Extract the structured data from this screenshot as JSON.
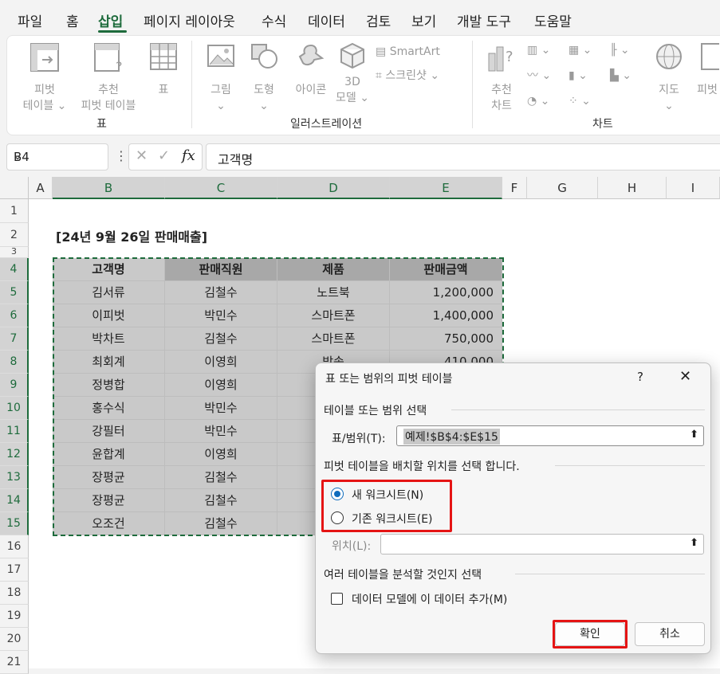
{
  "menu": {
    "tabs": [
      "파일",
      "홈",
      "삽입",
      "페이지 레이아웃",
      "수식",
      "데이터",
      "검토",
      "보기",
      "개발 도구",
      "도움말"
    ],
    "active": "삽입"
  },
  "ribbon": {
    "tables_group": {
      "label": "표",
      "pivot": [
        "피벗",
        "테이블"
      ],
      "recommended_pivot": [
        "추천",
        "피벗 테이블"
      ],
      "table": "표"
    },
    "illustrations_group": {
      "label": "일러스트레이션",
      "picture": "그림",
      "shapes": "도형",
      "icons": "아이콘",
      "model3d": [
        "3D",
        "모델"
      ],
      "smartart": "SmartArt",
      "screenshot": "스크린샷"
    },
    "charts_group": {
      "label": "차트",
      "recommended": [
        "추천",
        "차트"
      ],
      "map": "지도",
      "pivot_chart": "피벗"
    }
  },
  "formula_bar": {
    "name_box": "B4",
    "fx": "fx",
    "formula": "고객명"
  },
  "sheet": {
    "columns": [
      "A",
      "B",
      "C",
      "D",
      "E",
      "F",
      "G",
      "H",
      "I"
    ],
    "rows": [
      "1",
      "2",
      "3",
      "4",
      "5",
      "6",
      "7",
      "8",
      "9",
      "10",
      "11",
      "12",
      "13",
      "14",
      "15",
      "16",
      "17",
      "18",
      "19",
      "20",
      "21"
    ],
    "title": "[24년 9월 26일 판매매출]",
    "headers": [
      "고객명",
      "판매직원",
      "제품",
      "판매금액"
    ],
    "data": [
      [
        "김서류",
        "김철수",
        "노트북",
        "1,200,000"
      ],
      [
        "이피벗",
        "박민수",
        "스마트폰",
        "1,400,000"
      ],
      [
        "박차트",
        "김철수",
        "스마트폰",
        "750,000"
      ],
      [
        "최회계",
        "이영희",
        "방송",
        "410,000"
      ],
      [
        "정병합",
        "이영희",
        "",
        ""
      ],
      [
        "홍수식",
        "박민수",
        "스",
        ""
      ],
      [
        "강필터",
        "박민수",
        "",
        ""
      ],
      [
        "윤합계",
        "이영희",
        "스",
        ""
      ],
      [
        "장평균",
        "김철수",
        "",
        ""
      ],
      [
        "장평균",
        "김철수",
        "스",
        ""
      ],
      [
        "오조건",
        "김철수",
        "전",
        ""
      ]
    ]
  },
  "dialog": {
    "title": "표 또는 범위의 피벗 테이블",
    "help": "?",
    "close": "✕",
    "section1": "테이블 또는 범위 선택",
    "range_label": "표/범위(T):",
    "range_value": "예제!$B$4:$E$15",
    "section2": "피벗 테이블을 배치할 위치를 선택 합니다.",
    "new_sheet": "새 워크시트(N)",
    "existing_sheet": "기존 워크시트(E)",
    "location_label": "위치(L):",
    "location_value": "",
    "section3": "여러 테이블을 분석할 것인지 선택",
    "add_model": "데이터 모델에 이 데이터 추가(M)",
    "ok": "확인",
    "cancel": "취소"
  },
  "colors": {
    "accent": "#1e6b3c",
    "highlight": "#e51414",
    "radio": "#0f6cbd"
  }
}
